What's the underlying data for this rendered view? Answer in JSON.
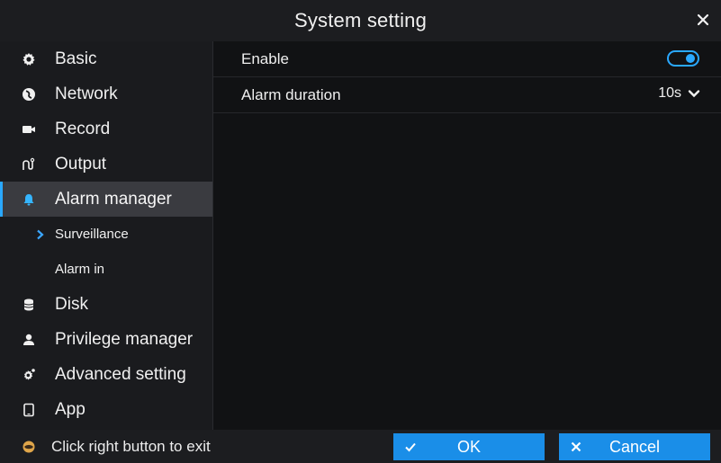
{
  "window": {
    "title": "System setting",
    "close_icon": "close-icon"
  },
  "sidebar": {
    "items": [
      {
        "label": "Basic",
        "icon": "gear-icon"
      },
      {
        "label": "Network",
        "icon": "globe-icon"
      },
      {
        "label": "Record",
        "icon": "video-camera-icon"
      },
      {
        "label": "Output",
        "icon": "output-icon"
      },
      {
        "label": "Alarm manager",
        "icon": "bell-icon",
        "active": true
      },
      {
        "label": "Surveillance",
        "sub": true,
        "selected": true
      },
      {
        "label": "Alarm in",
        "sub": true
      },
      {
        "label": "Disk",
        "icon": "database-icon"
      },
      {
        "label": "Privilege manager",
        "icon": "user-icon"
      },
      {
        "label": "Advanced setting",
        "icon": "advanced-gear-icon"
      },
      {
        "label": "App",
        "icon": "phone-icon"
      }
    ]
  },
  "content": {
    "enable": {
      "label": "Enable",
      "value": true
    },
    "alarm_duration": {
      "label": "Alarm duration",
      "value": "10s"
    }
  },
  "footer": {
    "hint": "Click right button to exit",
    "ok_label": "OK",
    "cancel_label": "Cancel"
  },
  "colors": {
    "accent": "#2aa8ff",
    "button": "#1a8ee8",
    "background": "#111214",
    "sidebar": "#1a1b1e"
  }
}
